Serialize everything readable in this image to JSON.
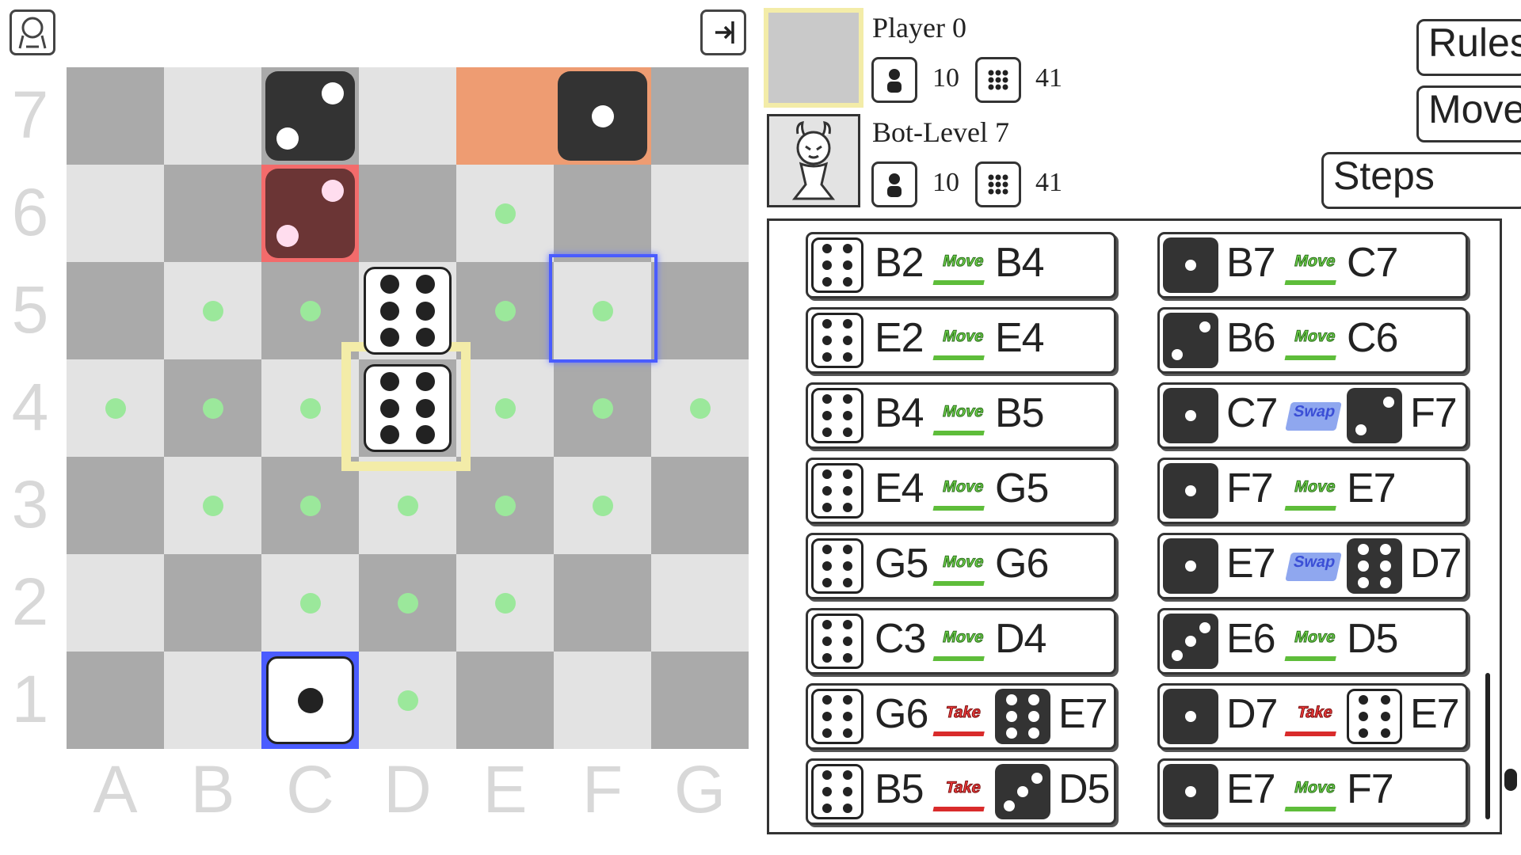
{
  "toolbar": {
    "left_icon": "player-profile-icon",
    "right_icon": "exit-icon"
  },
  "board": {
    "files": [
      "A",
      "B",
      "C",
      "D",
      "E",
      "F",
      "G"
    ],
    "ranks": [
      "7",
      "6",
      "5",
      "4",
      "3",
      "2",
      "1"
    ],
    "colors": {
      "dark": "#aaaaaa",
      "light": "#e3e3e3",
      "highlight_orange": "#ee9c72",
      "dot": "#9be89b",
      "blue": "#4a5cff",
      "yellow": "#f3eca8"
    }
  },
  "players": [
    {
      "name": "Player 0",
      "pieces": "10",
      "pips": "41"
    },
    {
      "name": "Bot-Level 7",
      "pieces": "10",
      "pips": "41"
    }
  ],
  "buttons": {
    "rules": "Rules",
    "move": "Move",
    "steps": "Steps"
  },
  "moves": [
    {
      "die_pips": 6,
      "die_color": "white",
      "from": "B2",
      "action": "Move",
      "to": "B4"
    },
    {
      "die_pips": 1,
      "die_color": "black",
      "from": "B7",
      "action": "Move",
      "to": "C7"
    },
    {
      "die_pips": 6,
      "die_color": "white",
      "from": "E2",
      "action": "Move",
      "to": "E4"
    },
    {
      "die_pips": 2,
      "die_color": "black",
      "from": "B6",
      "action": "Move",
      "to": "C6"
    },
    {
      "die_pips": 6,
      "die_color": "white",
      "from": "B4",
      "action": "Move",
      "to": "B5"
    },
    {
      "die_pips": 1,
      "die_color": "black",
      "from": "C7",
      "action": "Swap",
      "target_pips": 2,
      "target_color": "black",
      "to": "F7"
    },
    {
      "die_pips": 6,
      "die_color": "white",
      "from": "E4",
      "action": "Move",
      "to": "G5"
    },
    {
      "die_pips": 1,
      "die_color": "black",
      "from": "F7",
      "action": "Move",
      "to": "E7"
    },
    {
      "die_pips": 6,
      "die_color": "white",
      "from": "G5",
      "action": "Move",
      "to": "G6"
    },
    {
      "die_pips": 1,
      "die_color": "black",
      "from": "E7",
      "action": "Swap",
      "target_pips": 6,
      "target_color": "black",
      "to": "D7"
    },
    {
      "die_pips": 6,
      "die_color": "white",
      "from": "C3",
      "action": "Move",
      "to": "D4"
    },
    {
      "die_pips": 3,
      "die_color": "black",
      "from": "E6",
      "action": "Move",
      "to": "D5"
    },
    {
      "die_pips": 6,
      "die_color": "white",
      "from": "G6",
      "action": "Take",
      "target_pips": 6,
      "target_color": "black",
      "to": "E7"
    },
    {
      "die_pips": 1,
      "die_color": "black",
      "from": "D7",
      "action": "Take",
      "target_pips": 6,
      "target_color": "white",
      "to": "E7"
    },
    {
      "die_pips": 6,
      "die_color": "white",
      "from": "B5",
      "action": "Take",
      "target_pips": 3,
      "target_color": "black",
      "to": "D5"
    },
    {
      "die_pips": 1,
      "die_color": "black",
      "from": "E7",
      "action": "Move",
      "to": "F7"
    }
  ]
}
